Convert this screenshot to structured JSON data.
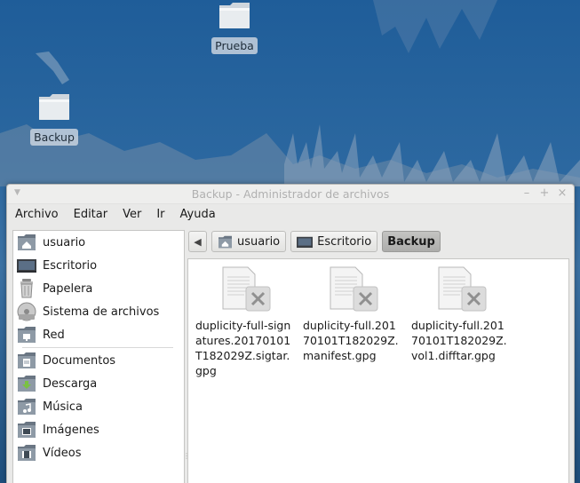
{
  "desktop": {
    "icons": [
      {
        "label": "Prueba"
      },
      {
        "label": "Backup"
      }
    ]
  },
  "window": {
    "title": "Backup - Administrador de archivos",
    "menu": [
      "Archivo",
      "Editar",
      "Ver",
      "Ir",
      "Ayuda"
    ],
    "sidebar": {
      "places": [
        {
          "label": "usuario",
          "icon": "home-folder-icon"
        },
        {
          "label": "Escritorio",
          "icon": "desktop-icon"
        },
        {
          "label": "Papelera",
          "icon": "trash-icon"
        },
        {
          "label": "Sistema de archivos",
          "icon": "drive-icon"
        },
        {
          "label": "Red",
          "icon": "network-icon"
        }
      ],
      "bookmarks": [
        {
          "label": "Documentos",
          "icon": "documents-folder-icon"
        },
        {
          "label": "Descarga",
          "icon": "download-folder-icon"
        },
        {
          "label": "Música",
          "icon": "music-folder-icon"
        },
        {
          "label": "Imágenes",
          "icon": "pictures-folder-icon"
        },
        {
          "label": "Vídeos",
          "icon": "videos-folder-icon"
        }
      ]
    },
    "pathbar": {
      "crumbs": [
        {
          "label": "usuario",
          "icon": "home-folder-icon"
        },
        {
          "label": "Escritorio",
          "icon": "desktop-icon"
        },
        {
          "label": "Backup",
          "active": true
        }
      ]
    },
    "files": [
      {
        "name": "duplicity-full-signatures.20170101T182029Z.sigtar.gpg",
        "icon": "broken-document-icon"
      },
      {
        "name": "duplicity-full.20170101T182029Z.manifest.gpg",
        "icon": "broken-document-icon"
      },
      {
        "name": "duplicity-full.20170101T182029Z.vol1.difftar.gpg",
        "icon": "broken-document-icon"
      }
    ]
  }
}
